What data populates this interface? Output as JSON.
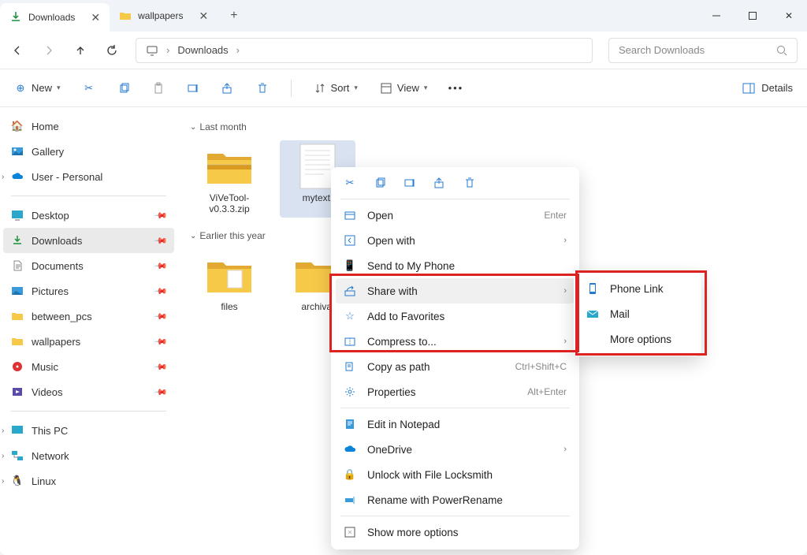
{
  "tabs": [
    {
      "label": "Downloads",
      "active": true
    },
    {
      "label": "wallpapers",
      "active": false
    }
  ],
  "breadcrumb": {
    "location": "Downloads"
  },
  "search": {
    "placeholder": "Search Downloads"
  },
  "toolbar": {
    "new_label": "New",
    "sort_label": "Sort",
    "view_label": "View",
    "details_label": "Details"
  },
  "sidebar": {
    "main": [
      {
        "label": "Home",
        "icon": "home"
      },
      {
        "label": "Gallery",
        "icon": "gallery"
      },
      {
        "label": "User - Personal",
        "icon": "onedrive",
        "expandable": true
      }
    ],
    "pinned": [
      {
        "label": "Desktop",
        "icon": "desktop"
      },
      {
        "label": "Downloads",
        "icon": "downloads",
        "active": true
      },
      {
        "label": "Documents",
        "icon": "documents"
      },
      {
        "label": "Pictures",
        "icon": "pictures"
      },
      {
        "label": "between_pcs",
        "icon": "folder"
      },
      {
        "label": "wallpapers",
        "icon": "folder"
      },
      {
        "label": "Music",
        "icon": "music"
      },
      {
        "label": "Videos",
        "icon": "videos"
      }
    ],
    "locations": [
      {
        "label": "This PC",
        "icon": "pc"
      },
      {
        "label": "Network",
        "icon": "network"
      },
      {
        "label": "Linux",
        "icon": "linux"
      }
    ]
  },
  "groups": [
    {
      "label": "Last month",
      "items": [
        {
          "name": "ViVeTool-v0.3.3.zip",
          "type": "zip"
        },
        {
          "name": "mytext.",
          "type": "txt",
          "selected": true
        }
      ]
    },
    {
      "label": "Earlier this year",
      "items": [
        {
          "name": "files",
          "type": "folder"
        },
        {
          "name": "archival",
          "type": "folder"
        }
      ]
    }
  ],
  "context_menu": {
    "items": [
      {
        "label": "Open",
        "shortcut": "Enter",
        "icon": "open"
      },
      {
        "label": "Open with",
        "submenu": true,
        "icon": "openwith"
      },
      {
        "label": "Send to My Phone",
        "icon": "phone"
      },
      {
        "label": "Share with",
        "submenu": true,
        "icon": "share",
        "hover": true
      },
      {
        "label": "Add to Favorites",
        "icon": "star"
      },
      {
        "label": "Compress to...",
        "submenu": true,
        "icon": "compress"
      },
      {
        "label": "Copy as path",
        "shortcut": "Ctrl+Shift+C",
        "icon": "copypath"
      },
      {
        "label": "Properties",
        "shortcut": "Alt+Enter",
        "icon": "props"
      },
      {
        "label": "Edit in Notepad",
        "icon": "notepad",
        "divider_before": true
      },
      {
        "label": "OneDrive",
        "submenu": true,
        "icon": "onedrive"
      },
      {
        "label": "Unlock with File Locksmith",
        "icon": "lock"
      },
      {
        "label": "Rename with PowerRename",
        "icon": "rename"
      },
      {
        "label": "Show more options",
        "icon": "more",
        "divider_before": true
      }
    ]
  },
  "submenu": {
    "items": [
      {
        "label": "Phone Link",
        "icon": "phonelink"
      },
      {
        "label": "Mail",
        "icon": "mail"
      },
      {
        "label": "More options",
        "icon": ""
      }
    ]
  }
}
